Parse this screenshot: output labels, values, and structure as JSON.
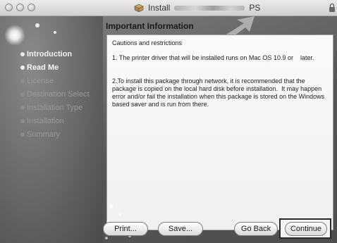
{
  "window": {
    "title": "Install",
    "title_suffix": "PS"
  },
  "sidebar": {
    "items": [
      {
        "label": "Introduction",
        "state": "done"
      },
      {
        "label": "Read Me",
        "state": "current"
      },
      {
        "label": "License",
        "state": "pending"
      },
      {
        "label": "Destination Select",
        "state": "pending"
      },
      {
        "label": "Installation Type",
        "state": "pending"
      },
      {
        "label": "Installation",
        "state": "pending"
      },
      {
        "label": "Summary",
        "state": "pending"
      }
    ]
  },
  "content": {
    "section_title": "Important Information",
    "paragraphs": [
      "Cautions and restrictions",
      "1. The printer driver that will be installed runs on Mac OS 10.9 or    later.",
      "2.To install this package through network, it is recommended that the package is copied on the local hard disk before installation.  It may happen error and/or fail the installation when this package is stored on the Windows based saver and is run from there."
    ]
  },
  "buttons": {
    "print": "Print...",
    "save": "Save...",
    "go_back": "Go Back",
    "continue": "Continue"
  }
}
